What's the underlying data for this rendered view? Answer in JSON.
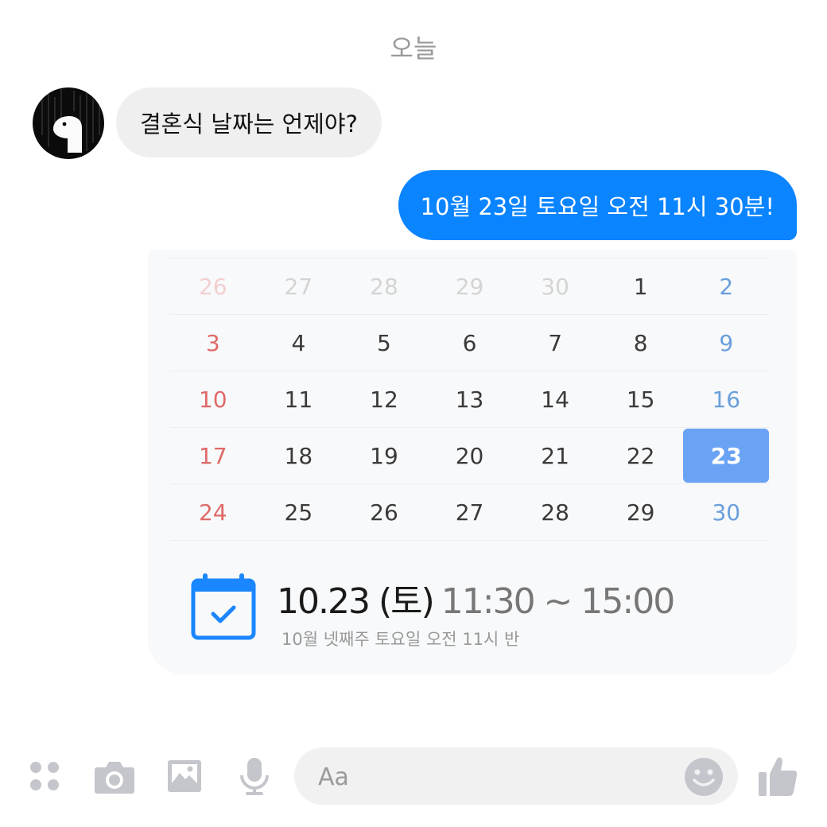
{
  "conversation": {
    "day_label": "오늘",
    "incoming": {
      "text": "결혼식 날짜는 언제야?"
    },
    "outgoing": {
      "text": "10월 23일 토요일 오전 11시 30분!"
    }
  },
  "calendar": {
    "weeks": [
      [
        {
          "d": "26",
          "t": "prev sun"
        },
        {
          "d": "27",
          "t": "prev"
        },
        {
          "d": "28",
          "t": "prev"
        },
        {
          "d": "29",
          "t": "prev"
        },
        {
          "d": "30",
          "t": "prev"
        },
        {
          "d": "1",
          "t": ""
        },
        {
          "d": "2",
          "t": "sat"
        }
      ],
      [
        {
          "d": "3",
          "t": "sun"
        },
        {
          "d": "4",
          "t": ""
        },
        {
          "d": "5",
          "t": ""
        },
        {
          "d": "6",
          "t": ""
        },
        {
          "d": "7",
          "t": ""
        },
        {
          "d": "8",
          "t": ""
        },
        {
          "d": "9",
          "t": "sat"
        }
      ],
      [
        {
          "d": "10",
          "t": "sun"
        },
        {
          "d": "11",
          "t": ""
        },
        {
          "d": "12",
          "t": ""
        },
        {
          "d": "13",
          "t": ""
        },
        {
          "d": "14",
          "t": ""
        },
        {
          "d": "15",
          "t": ""
        },
        {
          "d": "16",
          "t": "sat"
        }
      ],
      [
        {
          "d": "17",
          "t": "sun"
        },
        {
          "d": "18",
          "t": ""
        },
        {
          "d": "19",
          "t": ""
        },
        {
          "d": "20",
          "t": ""
        },
        {
          "d": "21",
          "t": ""
        },
        {
          "d": "22",
          "t": ""
        },
        {
          "d": "23",
          "t": "selected"
        }
      ],
      [
        {
          "d": "24",
          "t": "sun"
        },
        {
          "d": "25",
          "t": ""
        },
        {
          "d": "26",
          "t": ""
        },
        {
          "d": "27",
          "t": ""
        },
        {
          "d": "28",
          "t": ""
        },
        {
          "d": "29",
          "t": ""
        },
        {
          "d": "30",
          "t": "sat"
        }
      ]
    ],
    "event": {
      "date": "10.23 (토)",
      "time": "11:30 ~ 15:00",
      "subtitle": "10월 넷째주 토요일 오전 11시 반",
      "icon": "calendar-check-icon"
    }
  },
  "composer": {
    "placeholder": "Aa",
    "icons": [
      "apps-icon",
      "camera-icon",
      "image-icon",
      "microphone-icon",
      "emoji-icon",
      "thumbs-up-icon"
    ]
  },
  "colors": {
    "accent": "#0a84ff",
    "selected_day": "#6aa3f4",
    "sunday": "#df6a6a",
    "saturday": "#6a9fdc",
    "icon_gray": "#c4c6cc"
  }
}
